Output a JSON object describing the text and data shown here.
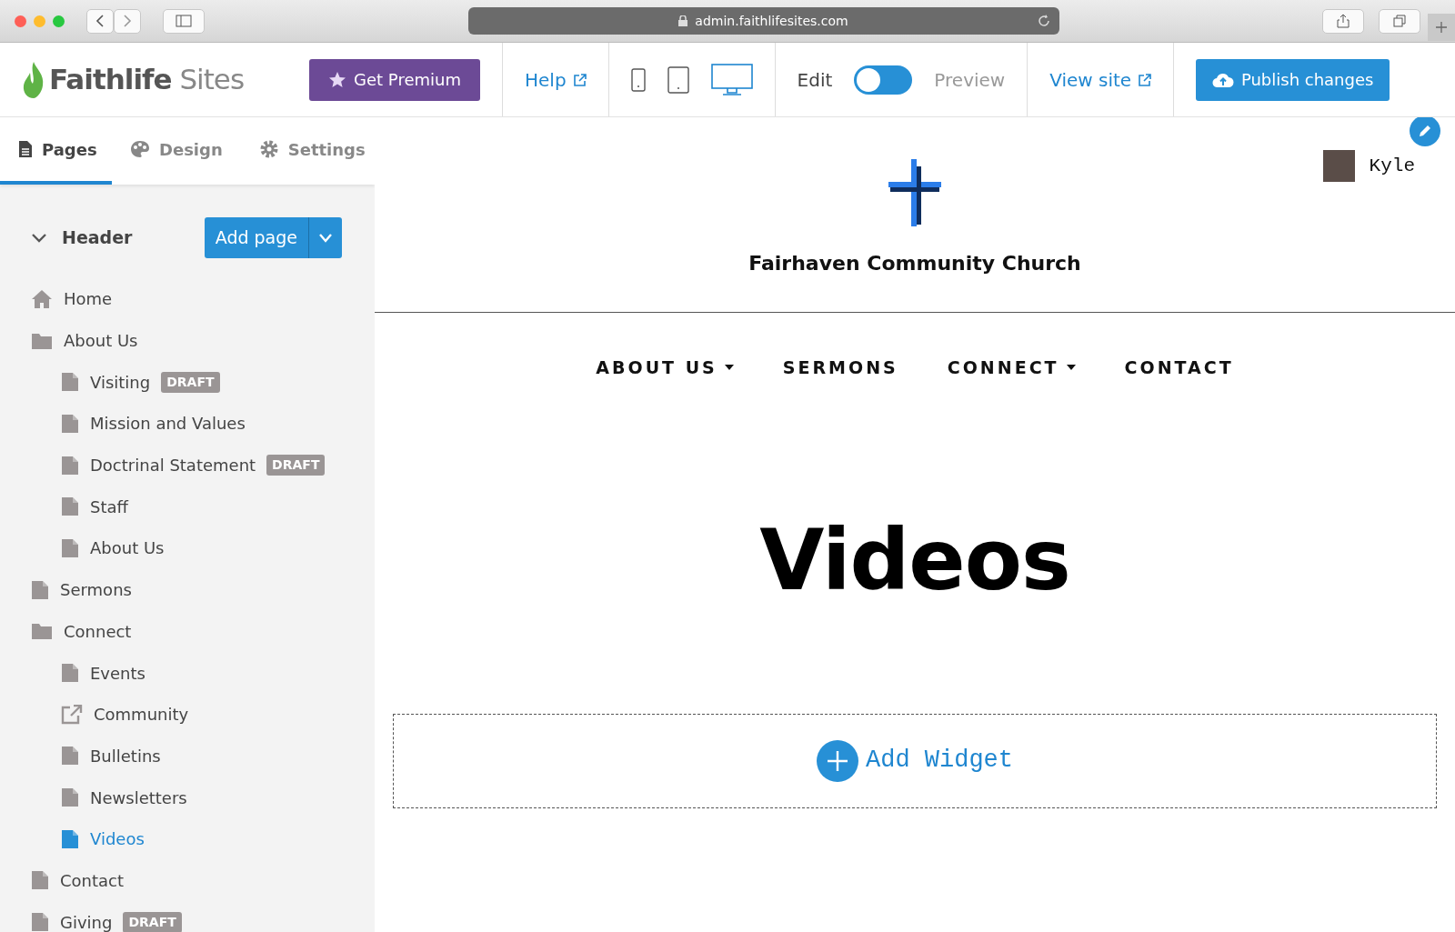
{
  "browser": {
    "url": "admin.faithlifesites.com"
  },
  "topbar": {
    "logo_primary": "Faithlife",
    "logo_secondary": "Sites",
    "premium_button": "Get Premium",
    "help_link": "Help",
    "devices": [
      {
        "kind": "phone",
        "selected": false
      },
      {
        "kind": "tablet",
        "selected": false
      },
      {
        "kind": "desktop",
        "selected": true
      }
    ],
    "mode": {
      "left_label": "Edit",
      "right_label": "Preview",
      "preview_on": false
    },
    "view_site_link": "View site",
    "publish_button": "Publish changes"
  },
  "sidebar": {
    "tabs": [
      {
        "label": "Pages",
        "kind": "pages",
        "selected": true
      },
      {
        "label": "Design",
        "kind": "design",
        "selected": false
      },
      {
        "label": "Settings",
        "kind": "settings",
        "selected": false
      }
    ],
    "section": {
      "label": "Header",
      "expanded": true
    },
    "add_page_button": "Add page",
    "items": [
      {
        "label": "Home",
        "kind": "home",
        "selected": false
      },
      {
        "label": "About Us",
        "kind": "folder",
        "selected": false,
        "children": [
          {
            "label": "Visiting",
            "kind": "page",
            "badge": "DRAFT",
            "selected": false
          },
          {
            "label": "Mission and Values",
            "kind": "page",
            "selected": false
          },
          {
            "label": "Doctrinal Statement",
            "kind": "page",
            "badge": "DRAFT",
            "selected": false
          },
          {
            "label": "Staff",
            "kind": "page",
            "selected": false
          },
          {
            "label": "About Us",
            "kind": "page",
            "selected": false
          }
        ]
      },
      {
        "label": "Sermons",
        "kind": "page",
        "selected": false
      },
      {
        "label": "Connect",
        "kind": "folder",
        "selected": false,
        "children": [
          {
            "label": "Events",
            "kind": "page",
            "selected": false
          },
          {
            "label": "Community",
            "kind": "link",
            "selected": false
          },
          {
            "label": "Bulletins",
            "kind": "page",
            "selected": false
          },
          {
            "label": "Newsletters",
            "kind": "page",
            "selected": false
          },
          {
            "label": "Videos",
            "kind": "page",
            "selected": true
          }
        ]
      },
      {
        "label": "Contact",
        "kind": "page",
        "selected": false
      },
      {
        "label": "Giving",
        "kind": "page",
        "badge": "DRAFT",
        "selected": false
      }
    ]
  },
  "preview": {
    "user_name": "Kyle",
    "church_name": "Fairhaven Community Church",
    "nav": [
      {
        "label": "ABOUT US",
        "has_dropdown": true
      },
      {
        "label": "SERMONS",
        "has_dropdown": false
      },
      {
        "label": "CONNECT",
        "has_dropdown": true
      },
      {
        "label": "CONTACT",
        "has_dropdown": false
      }
    ],
    "page_title": "Videos",
    "add_widget": "Add Widget"
  }
}
